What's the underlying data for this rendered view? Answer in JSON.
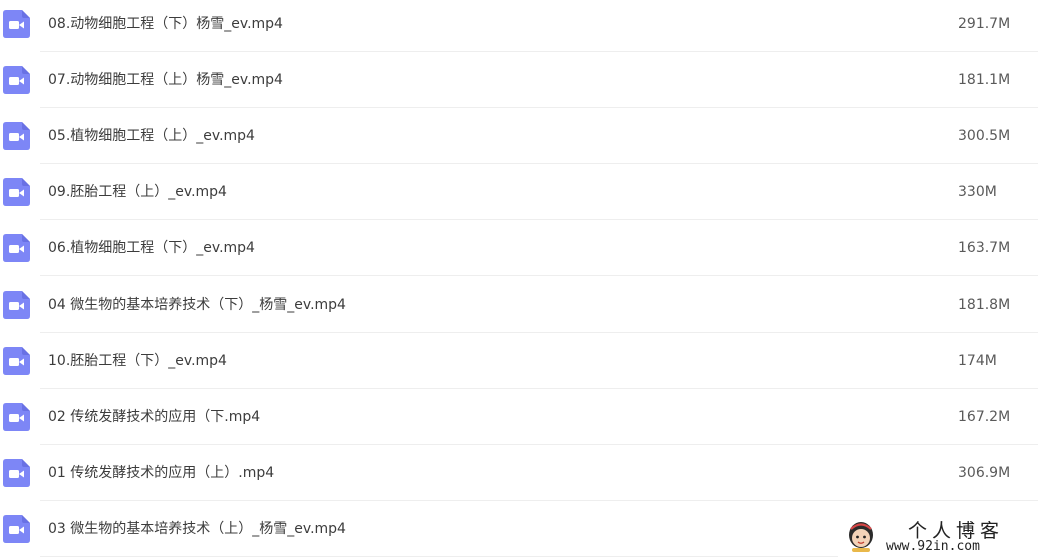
{
  "colors": {
    "icon_fill": "#7d86f6",
    "text": "#3c3c3c",
    "size_text": "#5a5a5a",
    "divider": "#eeeeee"
  },
  "icon": "video-file-icon",
  "files": [
    {
      "name": "08.动物细胞工程（下）杨雪_ev.mp4",
      "size": "291.7M"
    },
    {
      "name": "07.动物细胞工程（上）杨雪_ev.mp4",
      "size": "181.1M"
    },
    {
      "name": "05.植物细胞工程（上）_ev.mp4",
      "size": "300.5M"
    },
    {
      "name": "09.胚胎工程（上）_ev.mp4",
      "size": "330M"
    },
    {
      "name": "06.植物细胞工程（下）_ev.mp4",
      "size": "163.7M"
    },
    {
      "name": "04 微生物的基本培养技术（下）_杨雪_ev.mp4",
      "size": "181.8M"
    },
    {
      "name": "10.胚胎工程（下）_ev.mp4",
      "size": "174M"
    },
    {
      "name": "02 传统发酵技术的应用（下.mp4",
      "size": "167.2M"
    },
    {
      "name": "01 传统发酵技术的应用（上）.mp4",
      "size": "306.9M"
    },
    {
      "name": "03 微生物的基本培养技术（上）_杨雪_ev.mp4",
      "size": ""
    }
  ],
  "watermark": {
    "title": "个人博客",
    "url": "www.92in.com"
  }
}
